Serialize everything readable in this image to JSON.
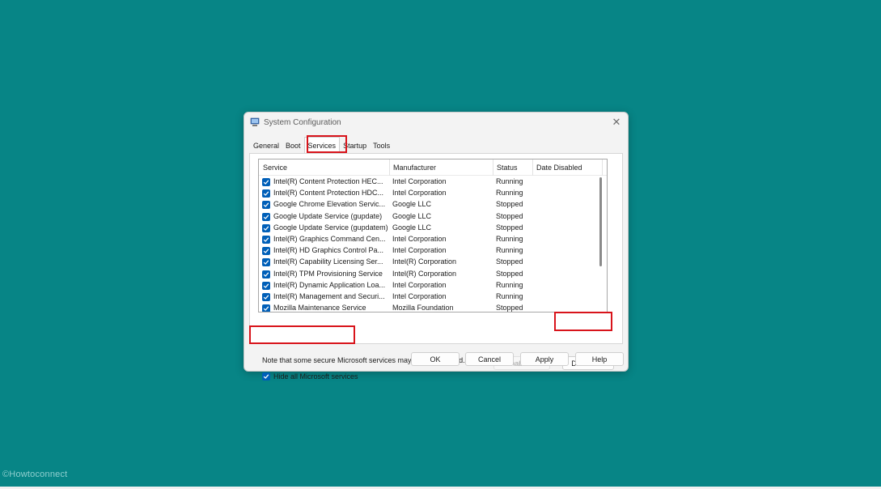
{
  "watermark": "©Howtoconnect",
  "dialog": {
    "title": "System Configuration",
    "close_glyph": "✕",
    "tabs": [
      {
        "label": "General"
      },
      {
        "label": "Boot"
      },
      {
        "label": "Services"
      },
      {
        "label": "Startup"
      },
      {
        "label": "Tools"
      }
    ],
    "active_tab": "Services",
    "columns": {
      "service": "Service",
      "manufacturer": "Manufacturer",
      "status": "Status",
      "date_disabled": "Date Disabled"
    },
    "services": [
      {
        "checked": true,
        "service": "Intel(R) Content Protection HEC...",
        "manufacturer": "Intel Corporation",
        "status": "Running"
      },
      {
        "checked": true,
        "service": "Intel(R) Content Protection HDC...",
        "manufacturer": "Intel Corporation",
        "status": "Running"
      },
      {
        "checked": true,
        "service": "Google Chrome Elevation Servic...",
        "manufacturer": "Google LLC",
        "status": "Stopped"
      },
      {
        "checked": true,
        "service": "Google Update Service (gupdate)",
        "manufacturer": "Google LLC",
        "status": "Stopped"
      },
      {
        "checked": true,
        "service": "Google Update Service (gupdatem)",
        "manufacturer": "Google LLC",
        "status": "Stopped"
      },
      {
        "checked": true,
        "service": "Intel(R) Graphics Command Cen...",
        "manufacturer": "Intel Corporation",
        "status": "Running"
      },
      {
        "checked": true,
        "service": "Intel(R) HD Graphics Control Pa...",
        "manufacturer": "Intel Corporation",
        "status": "Running"
      },
      {
        "checked": true,
        "service": "Intel(R) Capability Licensing Ser...",
        "manufacturer": "Intel(R) Corporation",
        "status": "Stopped"
      },
      {
        "checked": true,
        "service": "Intel(R) TPM Provisioning Service",
        "manufacturer": "Intel(R) Corporation",
        "status": "Stopped"
      },
      {
        "checked": true,
        "service": "Intel(R) Dynamic Application Loa...",
        "manufacturer": "Intel Corporation",
        "status": "Running"
      },
      {
        "checked": true,
        "service": "Intel(R) Management and Securi...",
        "manufacturer": "Intel Corporation",
        "status": "Running"
      },
      {
        "checked": true,
        "service": "Mozilla Maintenance Service",
        "manufacturer": "Mozilla Foundation",
        "status": "Stopped"
      }
    ],
    "note": "Note that some secure Microsoft services may not be disabled.",
    "enable_all": "Enable all",
    "disable_all": "Disable all",
    "hide_ms_label": "Hide all Microsoft services",
    "hide_ms_checked": true,
    "ok": "OK",
    "cancel": "Cancel",
    "apply": "Apply",
    "help": "Help"
  },
  "colors": {
    "desktop": "#078586",
    "checkbox": "#005fb8",
    "highlight": "#d8141b"
  }
}
